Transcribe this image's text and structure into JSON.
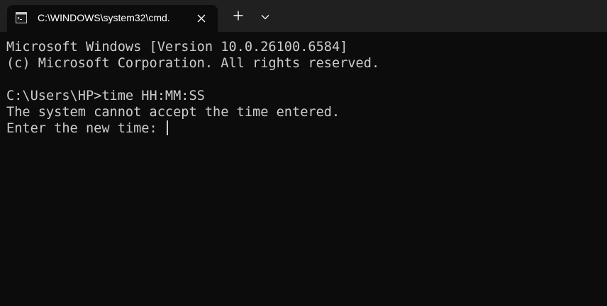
{
  "window": {
    "tab_title": "C:\\WINDOWS\\system32\\cmd.",
    "tab_icon": "cmd-icon",
    "close_icon": "close-icon",
    "new_tab_icon": "plus-icon",
    "dropdown_icon": "chevron-down-icon"
  },
  "console": {
    "lines": [
      "Microsoft Windows [Version 10.0.26100.6584]",
      "(c) Microsoft Corporation. All rights reserved.",
      "",
      "C:\\Users\\HP>time HH:MM:SS",
      "The system cannot accept the time entered.",
      "Enter the new time: "
    ]
  },
  "colors": {
    "background": "#0c0c0c",
    "tabbar": "#202020",
    "text": "#cccccc"
  }
}
